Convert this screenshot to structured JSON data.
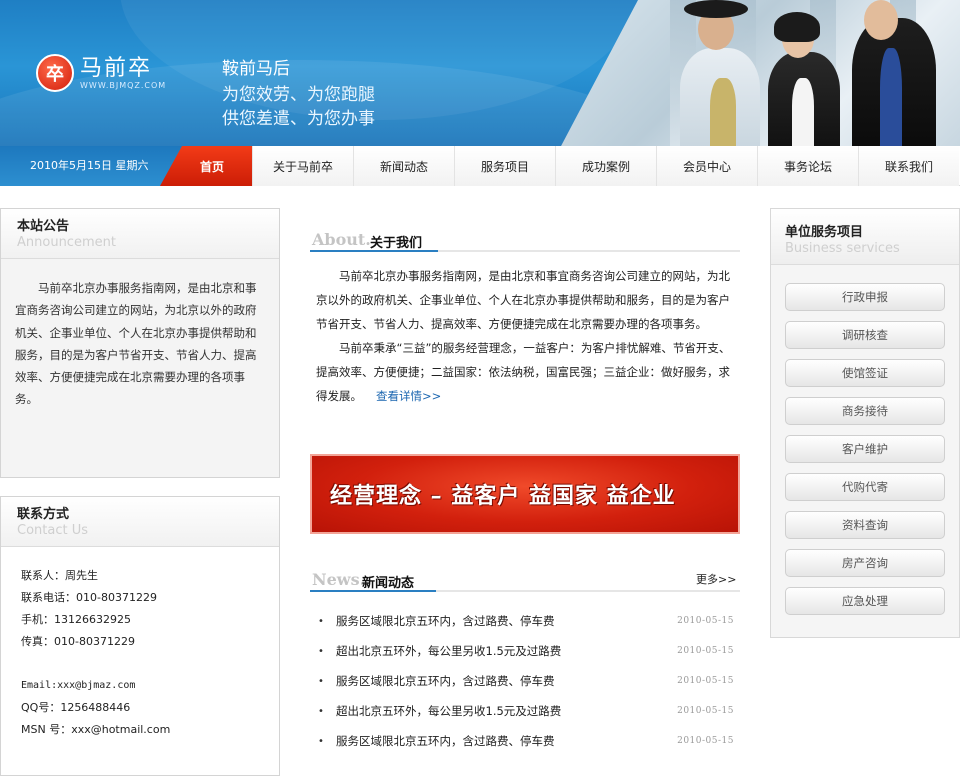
{
  "brand": {
    "logo_char": "卒",
    "name": "马前卒",
    "url_text": "WWW.BJMQZ.COM",
    "slogan_title": "鞍前马后",
    "slogan_line1": "为您效劳、为您跑腿",
    "slogan_line2": "供您差遣、为您办事"
  },
  "nav": {
    "date": "2010年5月15日 星期六",
    "home": "首页",
    "items": [
      "关于马前卒",
      "新闻动态",
      "服务项目",
      "成功案例",
      "会员中心",
      "事务论坛",
      "联系我们"
    ]
  },
  "announcement": {
    "title": "本站公告",
    "subtitle": "Announcement",
    "text": "马前卒北京办事服务指南网，是由北京和事宜商务咨询公司建立的网站，为北京以外的政府机关、企事业单位、个人在北京办事提供帮助和服务，目的是为客户节省开支、节省人力、提高效率、方便便捷完成在北京需要办理的各项事务。"
  },
  "contact": {
    "title": "联系方式",
    "subtitle": "Contact Us",
    "lines": [
      "联系人：周先生",
      "联系电话：010-80371229",
      "手机：13126632925",
      "传真：010-80371229"
    ],
    "lines2": [
      "Email:xxx@bjmaz.com",
      "QQ号：1256488446",
      "MSN 号：xxx@hotmail.com"
    ]
  },
  "about": {
    "en": "About.",
    "cn": "关于我们",
    "p1": "马前卒北京办事服务指南网，是由北京和事宜商务咨询公司建立的网站，为北京以外的政府机关、企事业单位、个人在北京办事提供帮助和服务，目的是为客户节省开支、节省人力、提高效率、方便便捷完成在北京需要办理的各项事务。",
    "p2": "马前卒秉承“三益”的服务经营理念，一益客户：为客户排忧解难、节省开支、提高效率、方便便捷；二益国家：依法纳税，国富民强；三益企业：做好服务，求得发展。",
    "more": "查看详情>>"
  },
  "ad": {
    "text": "经营理念 – 益客户 益国家 益企业"
  },
  "news": {
    "en": "News.",
    "cn": "新闻动态",
    "more": "更多>>",
    "items": [
      {
        "title": "服务区域限北京五环内，含过路费、停车费",
        "date": "2010-05-15"
      },
      {
        "title": "超出北京五环外，每公里另收1.5元及过路费",
        "date": "2010-05-15"
      },
      {
        "title": "服务区域限北京五环内，含过路费、停车费",
        "date": "2010-05-15"
      },
      {
        "title": "超出北京五环外，每公里另收1.5元及过路费",
        "date": "2010-05-15"
      },
      {
        "title": "服务区域限北京五环内，含过路费、停车费",
        "date": "2010-05-15"
      }
    ]
  },
  "services": {
    "title": "单位服务项目",
    "subtitle": "Business services",
    "items": [
      "行政申报",
      "调研核查",
      "使馆签证",
      "商务接待",
      "客户维护",
      "代购代寄",
      "资料查询",
      "房产咨询",
      "应急处理"
    ]
  },
  "colors": {
    "header_blue": "#2a95d6",
    "nav_active_red": "#e02a10",
    "accent_underline": "#2a7fc2",
    "link_blue": "#1b66b0"
  }
}
